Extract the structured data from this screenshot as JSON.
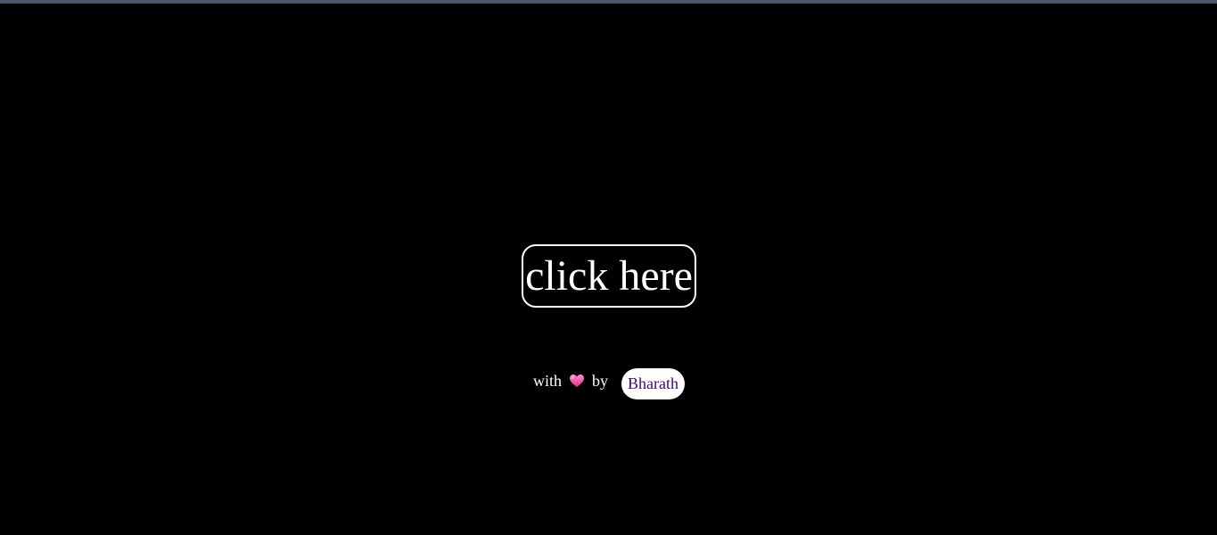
{
  "main": {
    "button_label": "click here"
  },
  "footer": {
    "with_text": "with",
    "heart_icon": "heart-icon",
    "by_text": "by",
    "author_name": "Bharath"
  },
  "colors": {
    "background": "#000000",
    "top_bar": "#4a5568",
    "button_border": "#ffffff",
    "heart": "#ff4fa3",
    "author_text": "#3b0a7a"
  }
}
